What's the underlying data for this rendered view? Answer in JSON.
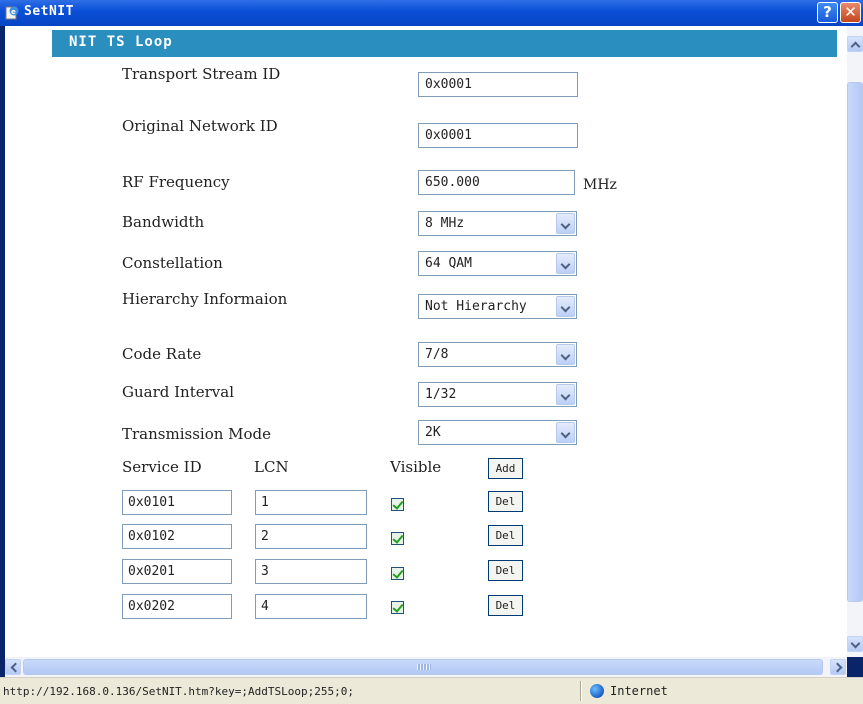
{
  "window": {
    "title": "SetNIT",
    "help_button": "?",
    "close_button": "✕"
  },
  "section": {
    "title": "NIT TS Loop"
  },
  "form": {
    "transport_stream_id": {
      "label": "Transport Stream ID",
      "value": "0x0001"
    },
    "original_network_id": {
      "label": "Original Network ID",
      "value": "0x0001"
    },
    "rf_frequency": {
      "label": "RF Frequency",
      "value": "650.000",
      "unit": "MHz"
    },
    "bandwidth": {
      "label": "Bandwidth",
      "value": "8 MHz"
    },
    "constellation": {
      "label": "Constellation",
      "value": "64 QAM"
    },
    "hierarchy": {
      "label": "Hierarchy Informaion",
      "value": "Not Hierarchy"
    },
    "code_rate": {
      "label": "Code Rate",
      "value": "7/8"
    },
    "guard_interval": {
      "label": "Guard Interval",
      "value": "1/32"
    },
    "transmission_mode": {
      "label": "Transmission Mode",
      "value": "2K"
    }
  },
  "services": {
    "headers": {
      "service_id": "Service ID",
      "lcn": "LCN",
      "visible": "Visible"
    },
    "add_label": "Add",
    "del_label": "Del",
    "rows": [
      {
        "service_id": "0x0101",
        "lcn": "1",
        "visible": true
      },
      {
        "service_id": "0x0102",
        "lcn": "2",
        "visible": true
      },
      {
        "service_id": "0x0201",
        "lcn": "3",
        "visible": true
      },
      {
        "service_id": "0x0202",
        "lcn": "4",
        "visible": true
      }
    ]
  },
  "status": {
    "url": "http://192.168.0.136/SetNIT.htm?key=;AddTSLoop;255;0;",
    "zone": "Internet"
  },
  "colors": {
    "titlebar": "#0b50d8",
    "section_header": "#2a8fbf",
    "checkbox_check": "#21a121"
  }
}
